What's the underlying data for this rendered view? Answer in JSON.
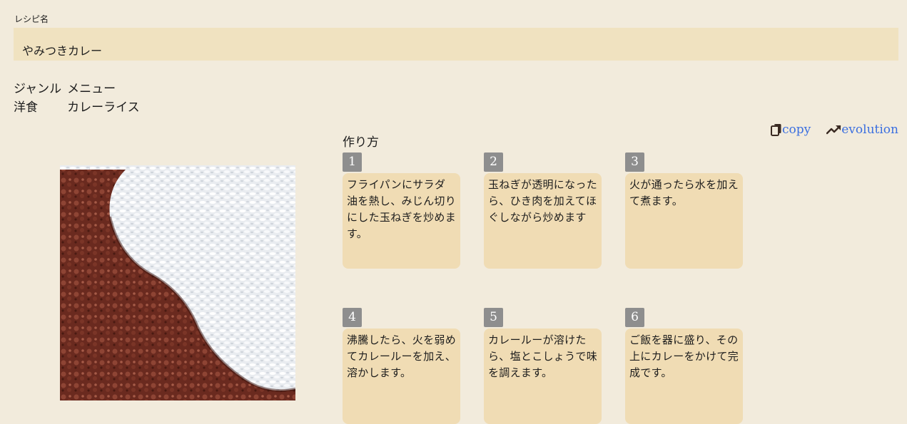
{
  "recipe": {
    "name_label": "レシピ名",
    "name": "やみつきカレー"
  },
  "classification": {
    "headers": [
      "ジャンル",
      "メニュー"
    ],
    "values": [
      "洋食",
      "カレーライス"
    ]
  },
  "actions": {
    "copy_label": "copy",
    "evolution_label": "evolution",
    "link_color": "#3b6fe0"
  },
  "steps_title": "作り方",
  "steps": [
    {
      "number": "1",
      "text": "フライパンにサラダ油を熱し、みじん切りにした玉ねぎを炒めます。"
    },
    {
      "number": "2",
      "text": "玉ねぎが透明になったら、ひき肉を加えてほぐしながら炒めます"
    },
    {
      "number": "3",
      "text": "火が通ったら水を加えて煮ます。"
    },
    {
      "number": "4",
      "text": "沸騰したら、火を弱めてカレールーを加え、溶かします。"
    },
    {
      "number": "5",
      "text": "カレールーが溶けたら、塩とこしょうで味を調えます。"
    },
    {
      "number": "6",
      "text": "ご飯を器に盛り、その上にカレーをかけて完成です。"
    }
  ],
  "colors": {
    "background": "#f2ebdc",
    "name_box": "#f0e2c0",
    "step_box": "#f0dcb4",
    "step_badge": "#8e8e8e"
  }
}
